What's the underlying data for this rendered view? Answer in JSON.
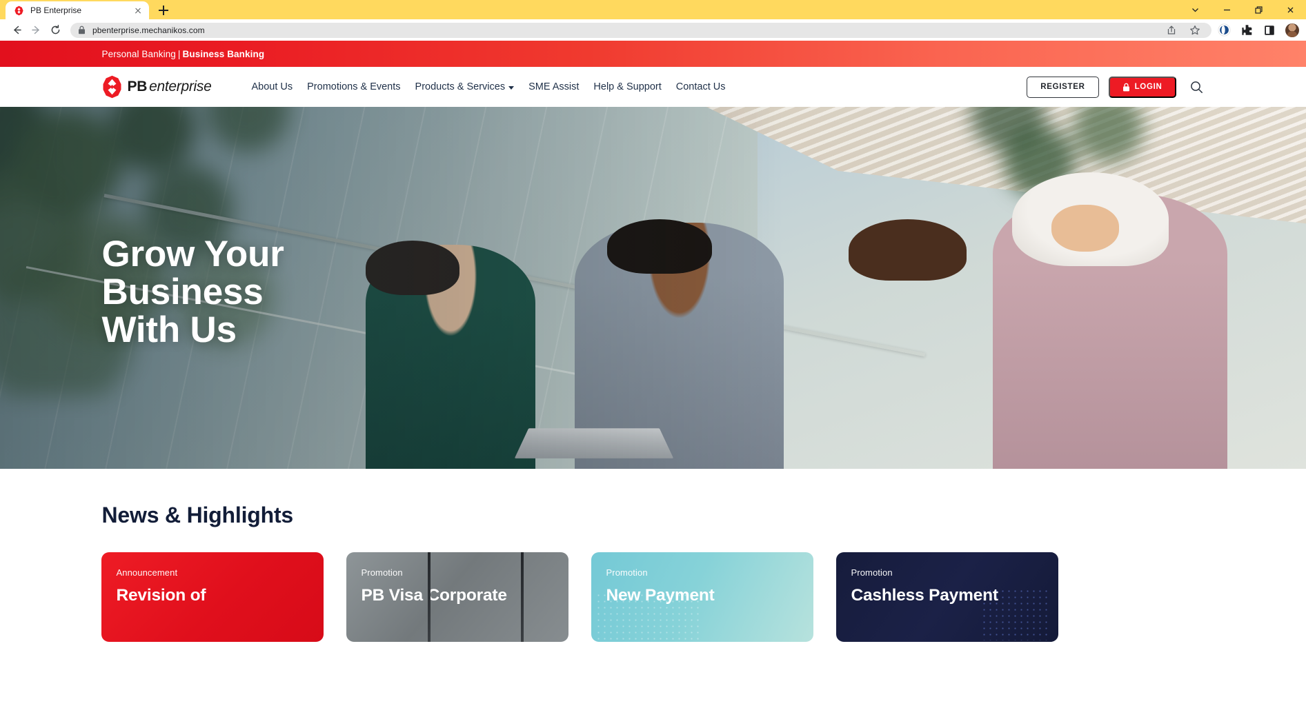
{
  "browser": {
    "tab": {
      "title": "PB Enterprise",
      "favicon": "pb-octagon-favicon",
      "close_icon": "close-icon"
    },
    "new_tab_icon": "plus-icon",
    "window_controls": [
      "chevron-down-icon",
      "minimize-icon",
      "restore-icon",
      "close-icon"
    ],
    "toolbar": {
      "back_icon": "back-arrow-icon",
      "forward_icon": "forward-arrow-icon",
      "reload_icon": "reload-icon",
      "lock_icon": "lock-icon",
      "url": "pbenterprise.mechanikos.com",
      "share_icon": "share-icon",
      "bookmark_icon": "star-icon",
      "opera_icon": "browser-assistant-icon",
      "extensions_icon": "puzzle-piece-icon",
      "sidebar_icon": "sidebar-panel-icon",
      "profile_icon": "user-avatar-icon"
    }
  },
  "site": {
    "utility_bar": {
      "personal": "Personal Banking",
      "separator": "|",
      "business": "Business Banking"
    },
    "logo": {
      "mark": "pb-octagon-logo",
      "pb": "PB",
      "enterprise": "enterprise"
    },
    "menu": [
      {
        "label": "About Us",
        "has_caret": false
      },
      {
        "label": "Promotions & Events",
        "has_caret": false
      },
      {
        "label": "Products & Services",
        "has_caret": true
      },
      {
        "label": "SME Assist",
        "has_caret": false
      },
      {
        "label": "Help & Support",
        "has_caret": false
      },
      {
        "label": "Contact Us",
        "has_caret": false
      }
    ],
    "register_label": "REGISTER",
    "login_label": "LOGIN",
    "login_icon": "lock-icon",
    "search_icon": "search-icon",
    "colors": {
      "brand_red": "#ed1b24",
      "deep_red": "#e2101d",
      "coral": "#ff8269",
      "navy_text": "#1f3048",
      "heading_navy": "#121d38"
    }
  },
  "hero": {
    "title_line1": "Grow Your",
    "title_line2": "Business",
    "title_line3": "With Us"
  },
  "news": {
    "heading": "News & Highlights",
    "cards": [
      {
        "kicker": "Announcement",
        "title_line1": "Revision of",
        "style": "card-1"
      },
      {
        "kicker": "Promotion",
        "title_line1": "PB Visa Corporate",
        "style": "card-2"
      },
      {
        "kicker": "Promotion",
        "title_line1": "New Payment",
        "style": "card-3"
      },
      {
        "kicker": "Promotion",
        "title_line1": "Cashless Payment",
        "style": "card-4"
      }
    ]
  }
}
